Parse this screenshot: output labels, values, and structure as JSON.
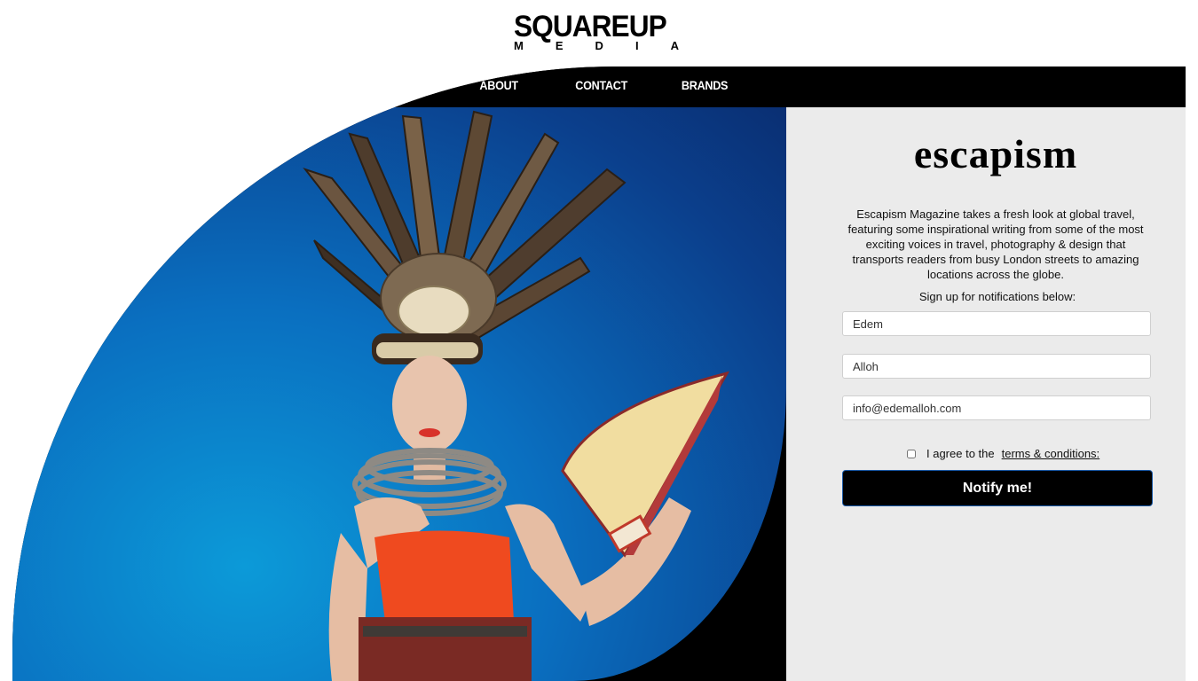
{
  "logo": {
    "main": "SQUAREUP",
    "sub_letters": [
      "M",
      "E",
      "D",
      "I",
      "A"
    ]
  },
  "nav": {
    "items": [
      {
        "label": "About"
      },
      {
        "label": "Contact"
      },
      {
        "label": "Brands"
      }
    ]
  },
  "panel": {
    "brand": "escapism",
    "description": "Escapism Magazine takes a fresh look at global travel, featuring some inspirational writing from some of the most exciting voices in travel, photography & design that transports readers from busy London streets to amazing locations across the globe.",
    "signup_label": "Sign up for notifications below:",
    "first_name_value": "Edem",
    "last_name_value": "Alloh",
    "email_value": "info@edemalloh.com",
    "agree_text": "I agree to the",
    "terms_link": "terms & conditions:",
    "notify_button": "Notify me!"
  },
  "colors": {
    "accent_black": "#000000",
    "panel_bg": "#ebebeb",
    "photo_blue": "#0a6fc0",
    "button_border": "#1b5aa8"
  }
}
